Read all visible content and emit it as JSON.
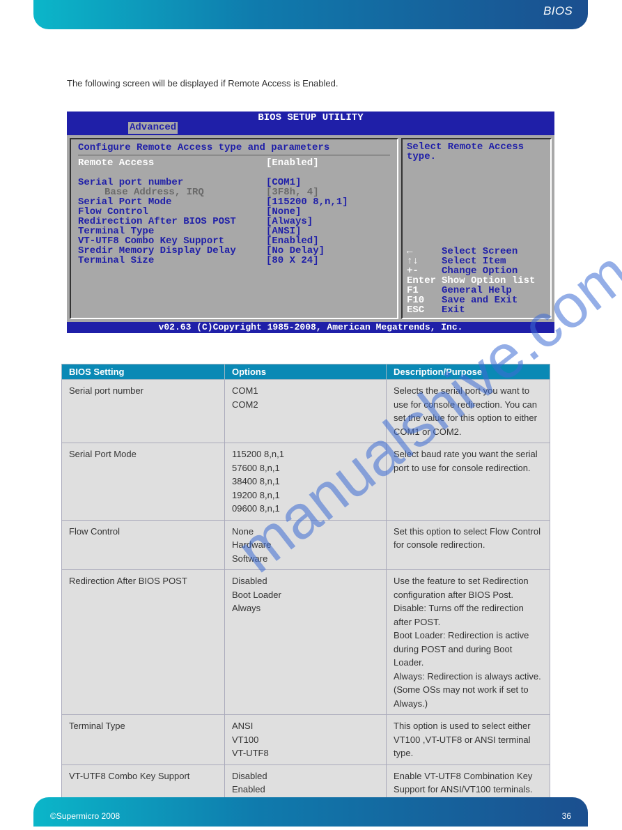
{
  "header": {
    "title": "BIOS"
  },
  "intro": {
    "text": "The following screen will be displayed if Remote Access is Enabled."
  },
  "bios": {
    "title": "BIOS SETUP UTILITY",
    "tab": "Advanced",
    "section_title": "Configure Remote Access type and parameters",
    "settings": [
      {
        "label": "Remote Access",
        "value": "[Enabled]",
        "state": "selected"
      },
      {
        "label": "",
        "value": "",
        "state": "blank"
      },
      {
        "label": "Serial port number",
        "value": "[COM1]",
        "state": ""
      },
      {
        "label": "Base Address, IRQ",
        "value": "[3F8h, 4]",
        "state": "dim"
      },
      {
        "label": "Serial Port Mode",
        "value": "[115200 8,n,1]",
        "state": ""
      },
      {
        "label": "Flow Control",
        "value": "[None]",
        "state": ""
      },
      {
        "label": "Redirection After BIOS POST",
        "value": "[Always]",
        "state": ""
      },
      {
        "label": "Terminal Type",
        "value": "[ANSI]",
        "state": ""
      },
      {
        "label": "VT-UTF8 Combo Key Support",
        "value": "[Enabled]",
        "state": ""
      },
      {
        "label": "Sredir Memory Display Delay",
        "value": "[No Delay]",
        "state": ""
      },
      {
        "label": "Terminal Size",
        "value": "[80 X 24]",
        "state": ""
      }
    ],
    "help_top": "Select Remote Access type.",
    "help_keys": [
      {
        "key": "←",
        "desc": "Select Screen",
        "white": false
      },
      {
        "key": "↑↓",
        "desc": "Select Item",
        "white": false
      },
      {
        "key": "+-",
        "desc": "Change Option",
        "white": false
      },
      {
        "key": "Enter",
        "desc": "Show Option list",
        "white": true
      },
      {
        "key": "F1",
        "desc": "General Help",
        "white": false
      },
      {
        "key": "F10",
        "desc": "Save and Exit",
        "white": false
      },
      {
        "key": "ESC",
        "desc": "Exit",
        "white": false
      }
    ],
    "footer": "v02.63 (C)Copyright 1985-2008, American Megatrends, Inc."
  },
  "table": {
    "headers": [
      "BIOS Setting",
      "Options",
      "Description/Purpose"
    ],
    "rows": [
      {
        "setting": "Serial port number",
        "options": "COM1\nCOM2",
        "desc": "Selects the serial port you want to use for console redirection. You can set the value for this option to either COM1 or COM2."
      },
      {
        "setting": "Serial Port Mode",
        "options": "115200 8,n,1\n57600 8,n,1\n38400 8,n,1\n19200 8,n,1\n09600 8,n,1",
        "desc": "Select baud rate you want the serial port to use for console redirection."
      },
      {
        "setting": "Flow Control",
        "options": "None\nHardware\nSoftware",
        "desc": "Set this option to select Flow Control for console redirection."
      },
      {
        "setting": "Redirection After BIOS POST",
        "options": "Disabled\nBoot Loader\nAlways",
        "desc": "Use the feature to set Redirection configuration after BIOS Post.\nDisable: Turns off the redirection after POST.\nBoot Loader: Redirection is active during POST and during Boot Loader.\nAlways: Redirection is always active. (Some OSs may not work if set to Always.)"
      },
      {
        "setting": "Terminal Type",
        "options": "ANSI\nVT100\nVT-UTF8",
        "desc": "This option is used to select either VT100 ,VT-UTF8 or ANSI terminal type."
      },
      {
        "setting": "VT-UTF8 Combo Key Support",
        "options": "Disabled\nEnabled",
        "desc": "Enable VT-UTF8 Combination Key Support for ANSI/VT100 terminals."
      }
    ]
  },
  "footer": {
    "left": "©Supermicro 2008",
    "right": "36"
  },
  "watermark": "manualshive.com"
}
